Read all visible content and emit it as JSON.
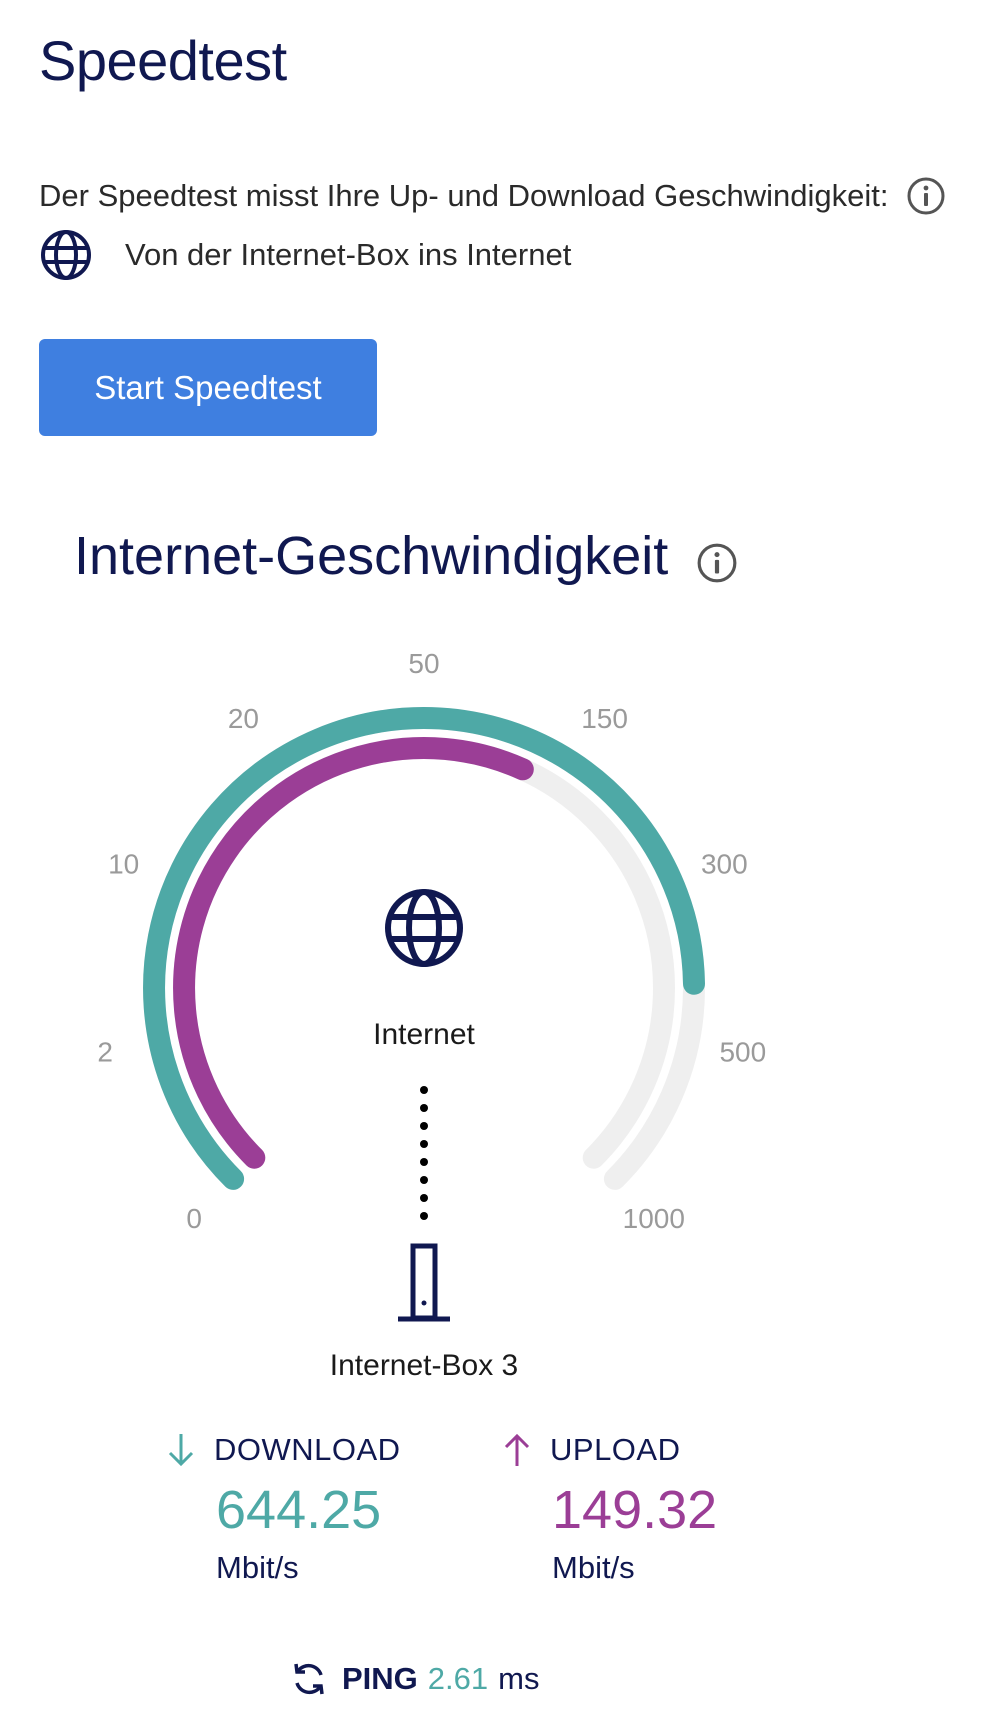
{
  "page": {
    "title": "Speedtest",
    "description": "Der Speedtest misst Ihre Up- und Download Geschwindigkeit:",
    "mode_label": "Von der Internet-Box ins Internet",
    "start_button_label": "Start Speedtest"
  },
  "speed_section": {
    "title": "Internet-Geschwindigkeit",
    "node_top_label": "Internet",
    "node_bottom_label": "Internet-Box 3"
  },
  "gauge": {
    "scale_labels": [
      "0",
      "2",
      "10",
      "20",
      "50",
      "150",
      "300",
      "500",
      "1000"
    ],
    "download_fraction": 0.83,
    "upload_fraction": 0.59,
    "download_color": "#4ea9a6",
    "upload_color": "#9b3e96",
    "track_color": "#efefef"
  },
  "results": {
    "download": {
      "label": "DOWNLOAD",
      "value": "644.25",
      "unit": "Mbit/s",
      "icon": "arrow-down-icon"
    },
    "upload": {
      "label": "UPLOAD",
      "value": "149.32",
      "unit": "Mbit/s",
      "icon": "arrow-up-icon"
    },
    "ping": {
      "label": "PING",
      "value": "2.61",
      "unit": "ms",
      "icon": "refresh-icon"
    }
  },
  "colors": {
    "brand_navy": "#101850",
    "button_blue": "#3f7fe0",
    "download_teal": "#4ea9a6",
    "upload_purple": "#9b3e96"
  }
}
